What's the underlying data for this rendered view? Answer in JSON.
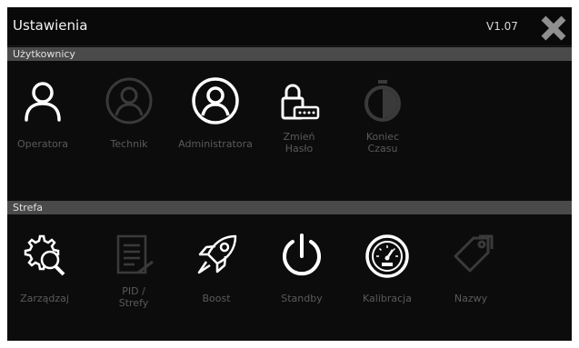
{
  "header": {
    "title": "Ustawienia",
    "version": "V1.07"
  },
  "sections": {
    "users": {
      "label": "Użytkownicy",
      "items": [
        {
          "label": "Operatora",
          "icon": "user-icon"
        },
        {
          "label": "Technik",
          "icon": "user-circle-icon"
        },
        {
          "label": "Administratora",
          "icon": "user-circle-icon"
        },
        {
          "label": "Zmień\nHasło",
          "icon": "lock-password-icon"
        },
        {
          "label": "Koniec\nCzasu",
          "icon": "stopwatch-icon"
        }
      ]
    },
    "zone": {
      "label": "Strefa",
      "items": [
        {
          "label": "Zarządzaj",
          "icon": "gear-search-icon"
        },
        {
          "label": "PID /\nStrefy",
          "icon": "document-pid-icon"
        },
        {
          "label": "Boost",
          "icon": "rocket-icon"
        },
        {
          "label": "Standby",
          "icon": "power-icon"
        },
        {
          "label": "Kalibracja",
          "icon": "gauge-icon"
        },
        {
          "label": "Nazwy",
          "icon": "tags-icon"
        }
      ]
    }
  },
  "colors": {
    "background": "#0c0c0c",
    "section_header": "#4a4a4a",
    "label": "#5a5a5a",
    "icon_active": "#ffffff",
    "icon_dim": "#3a3a3a"
  }
}
